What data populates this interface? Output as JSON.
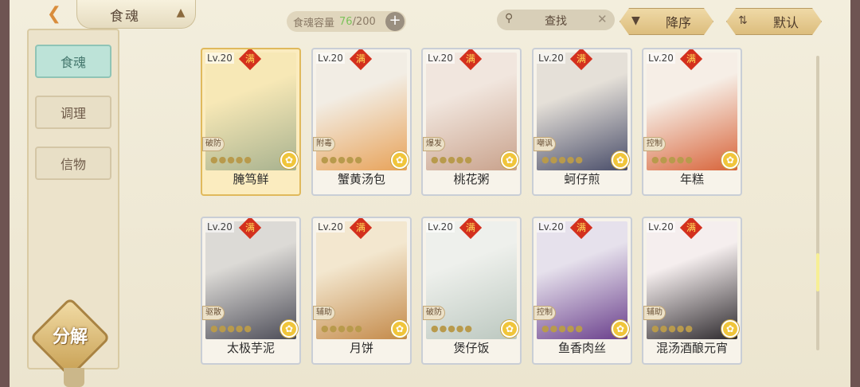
{
  "header": {
    "title": "食魂",
    "capacity_label": "食魂容量",
    "capacity_current": "76",
    "capacity_total": "/200",
    "search_label": "查找",
    "sort_order_label": "降序",
    "sort_default_label": "默认"
  },
  "sidebar": {
    "tabs": [
      {
        "label": "食魂"
      },
      {
        "label": "调理"
      },
      {
        "label": "信物"
      }
    ],
    "decompose_label": "分解"
  },
  "cards": [
    {
      "level": "Lv.20",
      "full": "满",
      "type": "破防",
      "name": "腌笃鲜",
      "palette": [
        "#f7e8b6",
        "#a8b28f"
      ]
    },
    {
      "level": "Lv.20",
      "full": "满",
      "type": "附毒",
      "name": "蟹黄汤包",
      "palette": [
        "#f2ede4",
        "#e8a35a"
      ]
    },
    {
      "level": "Lv.20",
      "full": "满",
      "type": "爆发",
      "name": "桃花粥",
      "palette": [
        "#f1e6de",
        "#c9a28c"
      ]
    },
    {
      "level": "Lv.20",
      "full": "满",
      "type": "嘲讽",
      "name": "蚵仔煎",
      "palette": [
        "#e5e0d8",
        "#4a4e6a"
      ]
    },
    {
      "level": "Lv.20",
      "full": "满",
      "type": "控制",
      "name": "年糕",
      "palette": [
        "#f6eee6",
        "#d8643a"
      ]
    },
    {
      "level": "Lv.20",
      "full": "满",
      "type": "驱散",
      "name": "太极芋泥",
      "palette": [
        "#dcdad6",
        "#4d4d58"
      ]
    },
    {
      "level": "Lv.20",
      "full": "满",
      "type": "辅助",
      "name": "月饼",
      "palette": [
        "#f3e7cf",
        "#c48a4a"
      ]
    },
    {
      "level": "Lv.20",
      "full": "满",
      "type": "破防",
      "name": "煲仔饭",
      "palette": [
        "#eef0ec",
        "#bcc8c0"
      ]
    },
    {
      "level": "Lv.20",
      "full": "满",
      "type": "控制",
      "name": "鱼香肉丝",
      "palette": [
        "#e6e1ec",
        "#6a3f8c"
      ]
    },
    {
      "level": "Lv.20",
      "full": "满",
      "type": "辅助",
      "name": "混汤酒酿元宵",
      "palette": [
        "#f5eeee",
        "#2e2a2e"
      ]
    }
  ]
}
